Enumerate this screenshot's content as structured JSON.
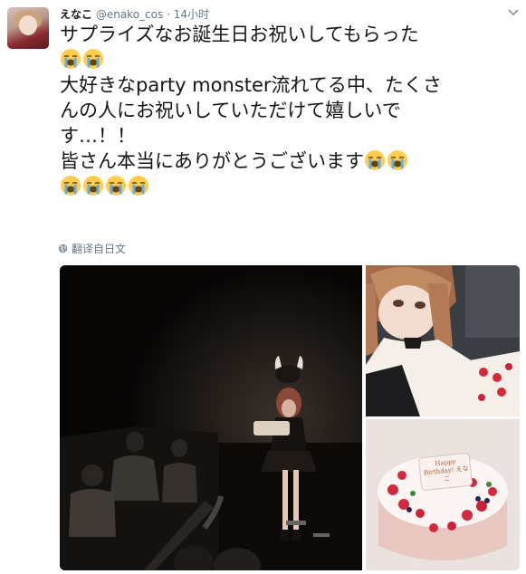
{
  "tweet": {
    "display_name": "えなこ",
    "handle": "@enako_cos",
    "separator": "·",
    "timestamp": "14小时",
    "lines": [
      "サプライズなお誕生日お祝いしてもらった",
      "大好きなparty monster流れてる中、たくさ",
      "んの人にお祝いしていただけて嬉しいで",
      "す…！！",
      "皆さん本当にありがとうございます"
    ],
    "translate_label": "翻译自日文",
    "cake_plate_text": "Happy Birthday! えなこ"
  },
  "icons": {
    "avatar": "avatar",
    "more": "chevron-down-icon",
    "emoji": "loudly-crying-face-icon",
    "translate": "globe-icon"
  },
  "colors": {
    "text": "#14171a",
    "secondary": "#657786",
    "emoji_face": "#ffcc4d",
    "emoji_tears": "#5dadec"
  }
}
